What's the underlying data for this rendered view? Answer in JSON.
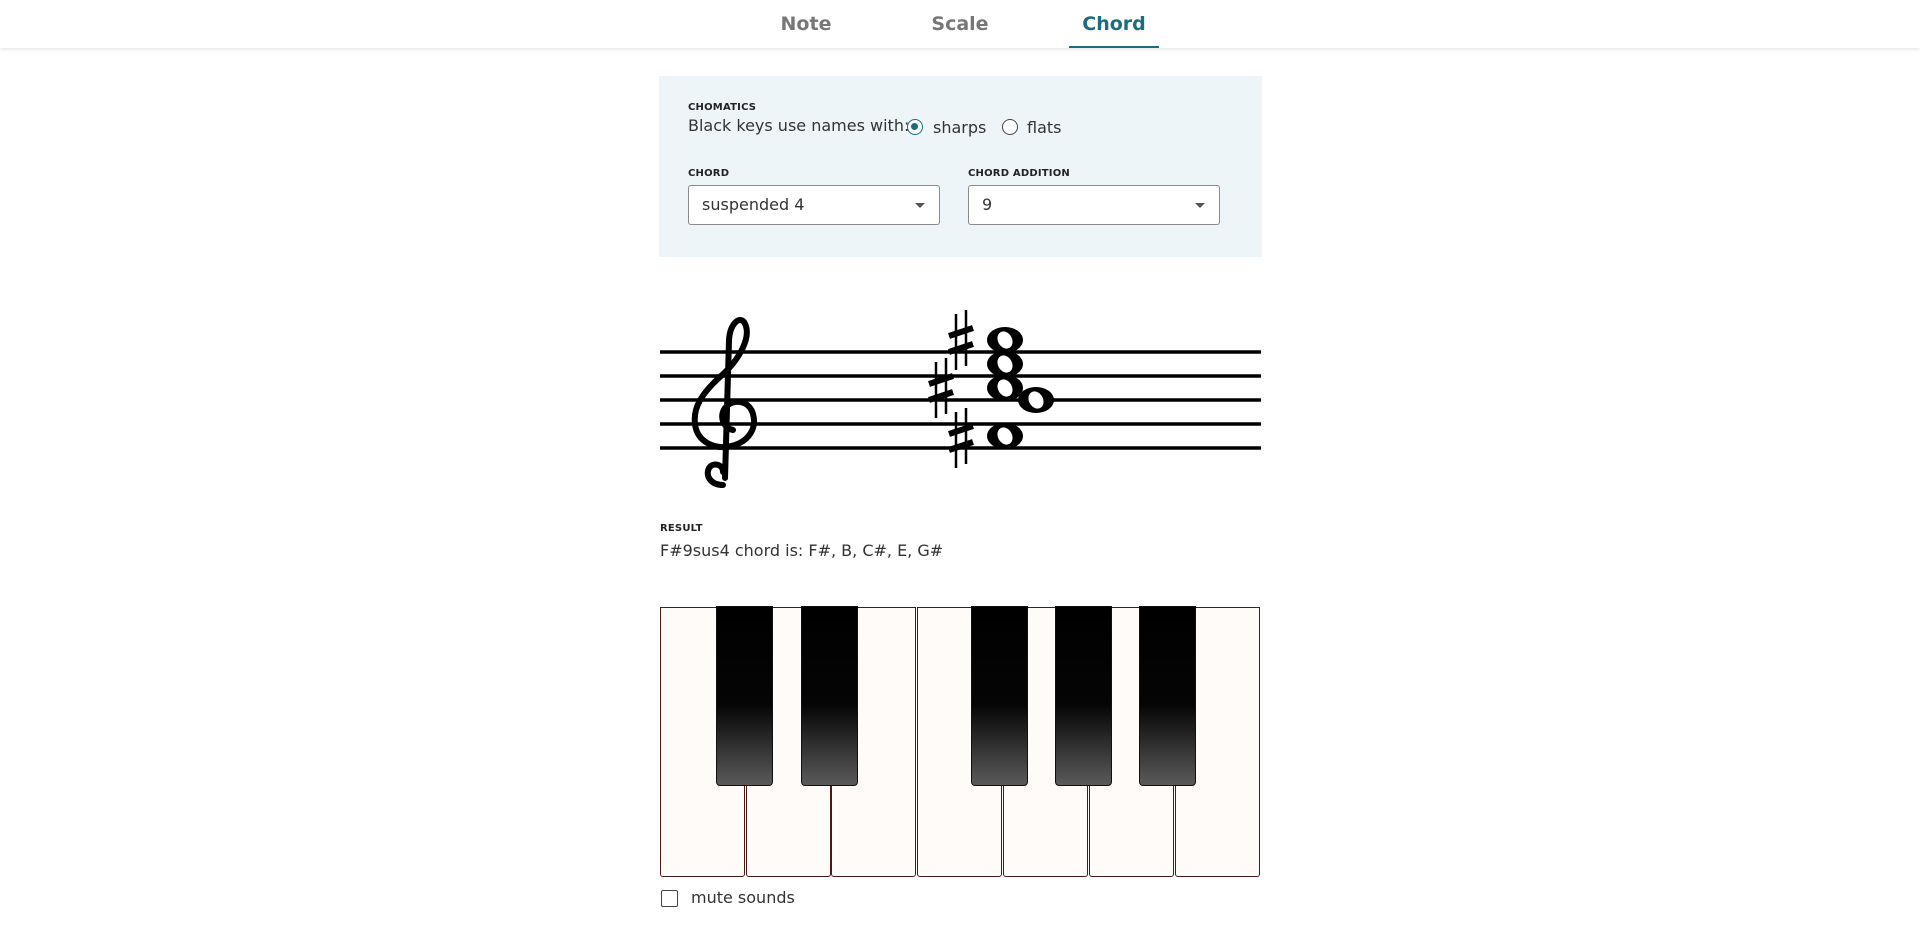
{
  "nav": {
    "tabs": [
      {
        "label": "Note",
        "active": false
      },
      {
        "label": "Scale",
        "active": false
      },
      {
        "label": "Chord",
        "active": true
      }
    ],
    "accent_color": "#1c6e7d"
  },
  "settings": {
    "chromatics_label": "CHOMATICS",
    "chromatics_prompt": "Black keys use names with:",
    "options": [
      {
        "label": "sharps",
        "checked": true
      },
      {
        "label": "flats",
        "checked": false
      }
    ],
    "chord_label": "CHORD",
    "chord_value": "suspended 4",
    "addition_label": "CHORD ADDITION",
    "addition_value": "9"
  },
  "staff": {
    "clef": "treble",
    "notes": [
      "F#4",
      "B4",
      "C#5",
      "E5",
      "G#5"
    ]
  },
  "result": {
    "label": "RESULT",
    "text": "F#9sus4 chord is: F#, B, C#, E, G#"
  },
  "piano": {
    "white_keys": 7,
    "black_keys": 5
  },
  "mute": {
    "label": "mute sounds",
    "checked": false
  }
}
